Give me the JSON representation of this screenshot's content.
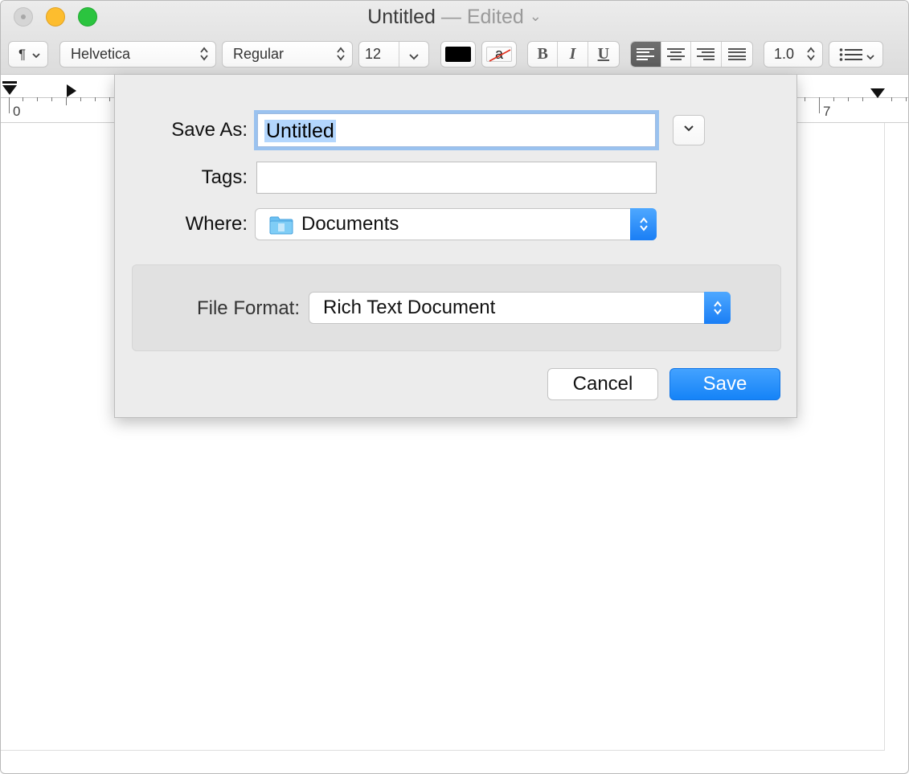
{
  "window": {
    "title": "Untitled",
    "title_separator": "—",
    "title_status": "Edited"
  },
  "toolbar": {
    "paragraph_style": "¶",
    "font_family": "Helvetica",
    "font_style": "Regular",
    "font_size": "12",
    "text_color": "#000000",
    "highlight_glyph": "a",
    "bold": "B",
    "italic": "I",
    "underline": "U",
    "line_spacing": "1.0",
    "active_alignment": "left"
  },
  "ruler": {
    "numbers": [
      "0",
      "7"
    ]
  },
  "save_dialog": {
    "save_as_label": "Save As:",
    "save_as_value": "Untitled",
    "tags_label": "Tags:",
    "tags_value": "",
    "where_label": "Where:",
    "where_value": "Documents",
    "file_format_label": "File Format:",
    "file_format_value": "Rich Text Document",
    "cancel_label": "Cancel",
    "save_label": "Save"
  },
  "colors": {
    "accent": "#1a7ef5",
    "focus_ring": "#9ac2ef",
    "selection": "#b3d6fd"
  }
}
